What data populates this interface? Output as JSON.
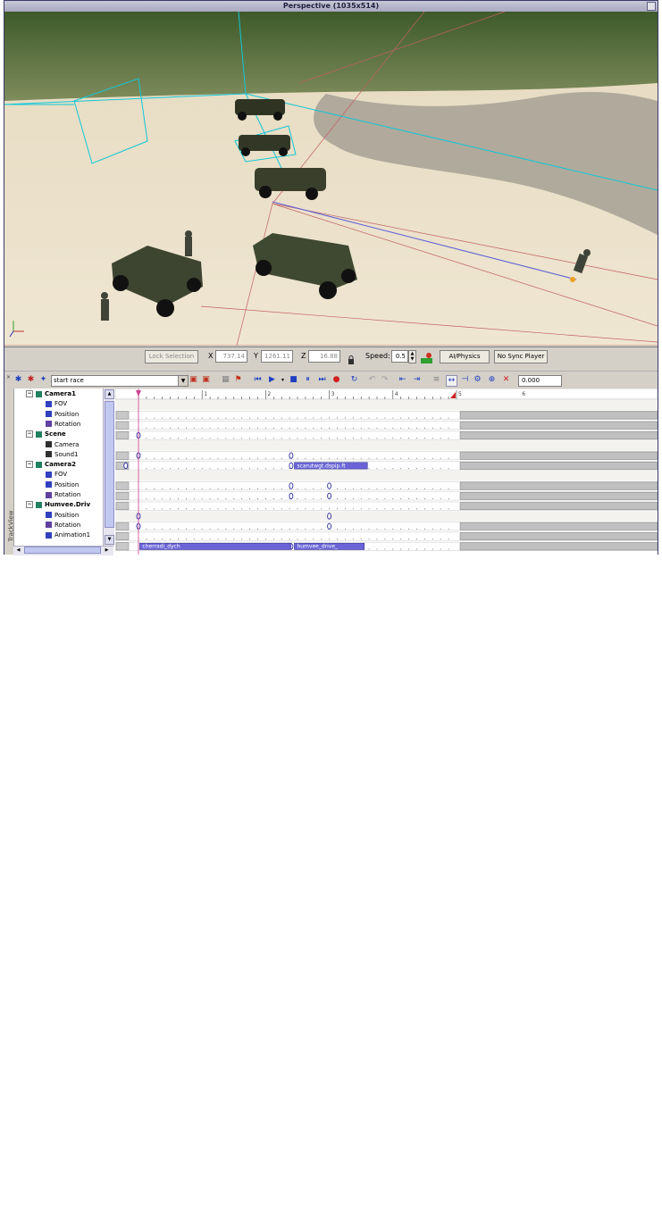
{
  "viewport": {
    "title": "Perspective (1035x514)"
  },
  "coordbar": {
    "lock_selection": "Lock Selection",
    "x_label": "X",
    "x_value": "737.14",
    "y_label": "Y",
    "y_value": "1261.11",
    "z_label": "Z",
    "z_value": "16.88",
    "speed_label": "Speed:",
    "speed_value": "0.5",
    "ai_physics": "AI/Physics",
    "no_sync_player": "No Sync Player"
  },
  "seqbar": {
    "sequence": "start race",
    "time": "0.000"
  },
  "tree": {
    "side_label": "TrackView",
    "items": [
      {
        "label": "Camera1",
        "bold": true,
        "level": 0,
        "icon": "camera-node-icon"
      },
      {
        "label": "FOV",
        "bold": false,
        "level": 1,
        "icon": "fov-icon"
      },
      {
        "label": "Position",
        "bold": false,
        "level": 1,
        "icon": "position-icon"
      },
      {
        "label": "Rotation",
        "bold": false,
        "level": 1,
        "icon": "rotation-icon"
      },
      {
        "label": "Scene",
        "bold": true,
        "level": 0,
        "icon": "scene-node-icon"
      },
      {
        "label": "Camera",
        "bold": false,
        "level": 1,
        "icon": "camera-icon"
      },
      {
        "label": "Sound1",
        "bold": false,
        "level": 1,
        "icon": "sound-icon"
      },
      {
        "label": "Camera2",
        "bold": true,
        "level": 0,
        "icon": "camera-node-icon"
      },
      {
        "label": "FOV",
        "bold": false,
        "level": 1,
        "icon": "fov-icon"
      },
      {
        "label": "Position",
        "bold": false,
        "level": 1,
        "icon": "position-icon"
      },
      {
        "label": "Rotation",
        "bold": false,
        "level": 1,
        "icon": "rotation-icon"
      },
      {
        "label": "Humvee.Driv",
        "bold": true,
        "level": 0,
        "icon": "entity-node-icon"
      },
      {
        "label": "Position",
        "bold": false,
        "level": 1,
        "icon": "position-icon"
      },
      {
        "label": "Rotation",
        "bold": false,
        "level": 1,
        "icon": "rotation-icon"
      },
      {
        "label": "Animation1",
        "bold": false,
        "level": 1,
        "icon": "animation-icon"
      }
    ]
  },
  "timeline": {
    "ruler": [
      "1",
      "2",
      "3",
      "4",
      "5",
      "6"
    ],
    "clips": [
      {
        "track": 6,
        "label": "scarutwgt.dspip.ft"
      },
      {
        "track": 14,
        "label": "cherradi_dych"
      },
      {
        "track": 14,
        "label": "humvee_drive_"
      }
    ]
  },
  "colors": {
    "clip": "#6a64d8",
    "cursor": "#d04090",
    "camera_frustum": "#00c8d8",
    "record": "#d02020"
  }
}
